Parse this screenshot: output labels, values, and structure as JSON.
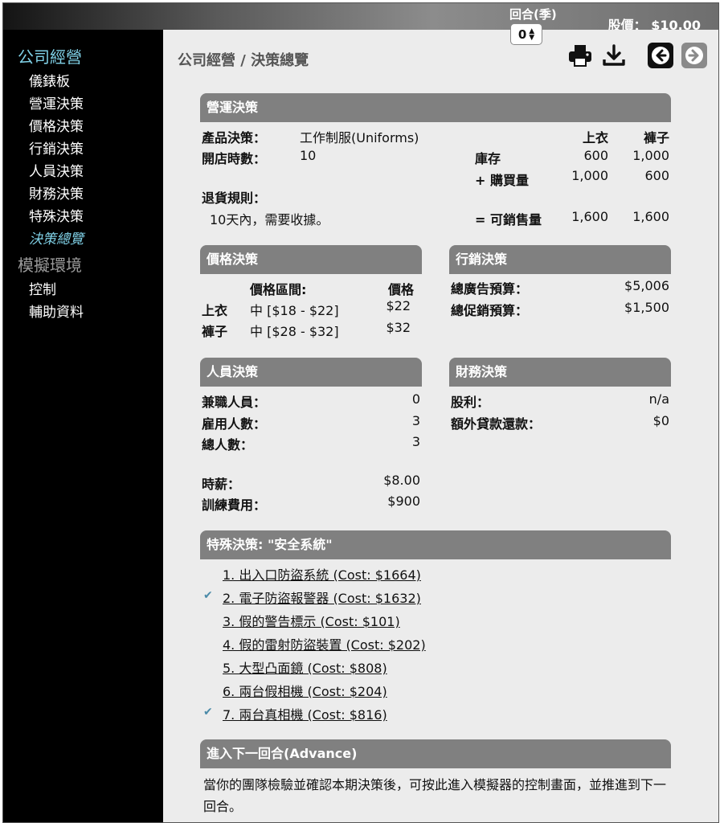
{
  "header": {
    "round_label": "回合(季)",
    "round_value": "0",
    "stock_price": "股價： $10.00"
  },
  "sidebar": {
    "company_heading": "公司經營",
    "company_items": [
      "儀錶板",
      "營運決策",
      "價格決策",
      "行銷決策",
      "人員決策",
      "財務決策",
      "特殊決策",
      "決策總覽"
    ],
    "env_heading": "模擬環境",
    "env_items": [
      "控制",
      "輔助資料"
    ]
  },
  "page": {
    "breadcrumb": "公司經營 / 決策總覽"
  },
  "operations": {
    "title": "營運決策",
    "product_label": "產品決策：",
    "product_value": "工作制服(Uniforms)",
    "hours_label": "開店時數：",
    "hours_value": "10",
    "return_label": "退貨規則：",
    "return_value": "10天內，需要收據。",
    "col_shirt": "上衣",
    "col_pants": "褲子",
    "inventory_label": "庫存",
    "inventory_shirt": "600",
    "inventory_pants": "1,000",
    "purchase_label": "+ 購買量",
    "purchase_shirt": "1,000",
    "purchase_pants": "600",
    "sellable_label": "= 可銷售量",
    "sellable_shirt": "1,600",
    "sellable_pants": "1,600"
  },
  "pricing": {
    "title": "價格決策",
    "range_header": "價格區間:",
    "price_header": "價格",
    "rows": [
      {
        "item": "上衣",
        "range": "中 [$18 - $22]",
        "price": "$22"
      },
      {
        "item": "褲子",
        "range": "中 [$28 - $32]",
        "price": "$32"
      }
    ]
  },
  "marketing": {
    "title": "行銷決策",
    "ad_label": "總廣告預算：",
    "ad_value": "$5,006",
    "promo_label": "總促銷預算：",
    "promo_value": "$1,500"
  },
  "staff": {
    "title": "人員決策",
    "parttime_label": "兼職人員：",
    "parttime_value": "0",
    "hired_label": "雇用人數：",
    "hired_value": "3",
    "total_label": "總人數：",
    "total_value": "3",
    "wage_label": "時薪：",
    "wage_value": "$8.00",
    "training_label": "訓練費用：",
    "training_value": "$900"
  },
  "finance": {
    "title": "財務決策",
    "dividend_label": "股利：",
    "dividend_value": "n/a",
    "loan_label": "額外貸款還款：",
    "loan_value": "$0"
  },
  "special": {
    "title": "特殊決策: \"安全系統\"",
    "items": [
      {
        "label": "1. 出入口防盜系統 (Cost: $1664)",
        "checked": false
      },
      {
        "label": "2. 電子防盜報警器 (Cost: $1632)",
        "checked": true
      },
      {
        "label": "3. 假的警告標示 (Cost: $101)",
        "checked": false
      },
      {
        "label": "4. 假的雷射防盜裝置 (Cost: $202)",
        "checked": false
      },
      {
        "label": "5. 大型凸面鏡 (Cost: $808)",
        "checked": false
      },
      {
        "label": "6. 兩台假相機 (Cost: $204)",
        "checked": false
      },
      {
        "label": "7. 兩台真相機 (Cost: $816)",
        "checked": true
      }
    ],
    "check_glyph": "✔"
  },
  "advance": {
    "title": "進入下一回合(Advance)",
    "description": "當你的團隊檢驗並確認本期決策後，可按此進入模擬器的控制畫面，並推進到下一回合。"
  },
  "icons": [
    "print-icon",
    "download-icon",
    "arrow-left-icon",
    "arrow-right-icon"
  ]
}
